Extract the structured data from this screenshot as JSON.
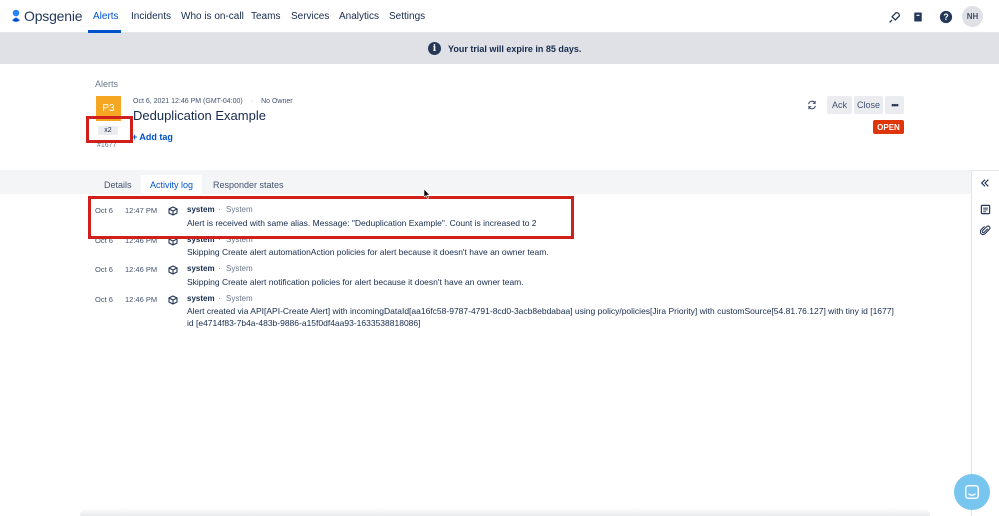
{
  "app": {
    "logo_text": "Opsgenie",
    "brand_color": "#0052cc"
  },
  "nav": {
    "items": [
      {
        "label": "Alerts",
        "active": true
      },
      {
        "label": "Incidents"
      },
      {
        "label": "Who is on-call"
      },
      {
        "label": "Teams"
      },
      {
        "label": "Services"
      },
      {
        "label": "Analytics"
      },
      {
        "label": "Settings"
      }
    ],
    "right_icons": [
      "rocket-icon",
      "book-icon",
      "help-icon"
    ],
    "avatar_initials": "NH"
  },
  "banner": {
    "icon": "info-icon",
    "text": "Your trial will expire in 85 days."
  },
  "alert": {
    "breadcrumb": "Alerts",
    "priority": "P3",
    "priority_color": "#f5a623",
    "created": "Oct 6, 2021 12:46 PM (GMT-04:00)",
    "owner": "No Owner",
    "title": "Deduplication Example",
    "count": "x2",
    "id": "#1677",
    "add_tag": "+ Add tag",
    "status": "OPEN",
    "status_color": "#de350b",
    "actions": {
      "ack": "Ack",
      "close": "Close",
      "more": "•••"
    }
  },
  "tabs": [
    {
      "label": "Details"
    },
    {
      "label": "Activity log",
      "active": true
    },
    {
      "label": "Responder states"
    }
  ],
  "activity_log": [
    {
      "date": "Oct 6",
      "time": "12:47 PM",
      "user": "system",
      "source": "System",
      "message": "Alert is received with same alias. Message: \"Deduplication Example\". Count is increased to 2"
    },
    {
      "date": "Oct 6",
      "time": "12:46 PM",
      "user": "system",
      "source": "System",
      "message": "Skipping Create alert automationAction policies for alert because it doesn't have an owner team."
    },
    {
      "date": "Oct 6",
      "time": "12:46 PM",
      "user": "system",
      "source": "System",
      "message": "Skipping Create alert notification policies for alert because it doesn't have an owner team."
    },
    {
      "date": "Oct 6",
      "time": "12:46 PM",
      "user": "system",
      "source": "System",
      "message": "Alert created via API[API-Create Alert] with incomingDataId[aa16fc58-9787-4791-8cd0-3acb8ebdabaa] using policy/policies[Jira Priority] with customSource[54.81.76.127] with tiny id [1677] id [e4714f83-7b4a-483b-9886-a15f0df4aa93-1633538818086]"
    }
  ],
  "side_icons": [
    "collapse-icon",
    "notes-icon",
    "attachment-icon"
  ],
  "annotation_color": "#d0201c"
}
